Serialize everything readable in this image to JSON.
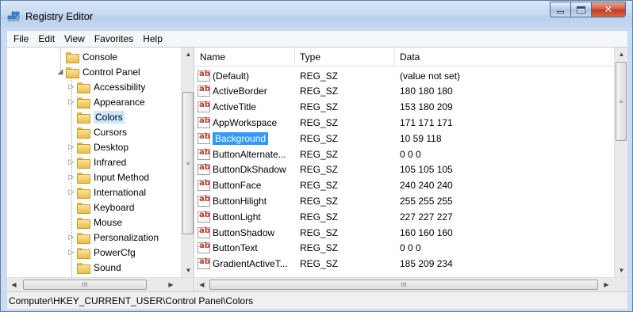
{
  "window": {
    "title": "Registry Editor",
    "close_glyph": "✕"
  },
  "menu": [
    "File",
    "Edit",
    "View",
    "Favorites",
    "Help"
  ],
  "tree": {
    "items": [
      {
        "label": "Console",
        "level": 2,
        "expander": "",
        "selected": false
      },
      {
        "label": "Control Panel",
        "level": 2,
        "expander": "◢",
        "selected": false
      },
      {
        "label": "Accessibility",
        "level": 3,
        "expander": "▷",
        "selected": false
      },
      {
        "label": "Appearance",
        "level": 3,
        "expander": "▷",
        "selected": false
      },
      {
        "label": "Colors",
        "level": 3,
        "expander": "",
        "selected": true
      },
      {
        "label": "Cursors",
        "level": 3,
        "expander": "",
        "selected": false
      },
      {
        "label": "Desktop",
        "level": 3,
        "expander": "▷",
        "selected": false
      },
      {
        "label": "Infrared",
        "level": 3,
        "expander": "▷",
        "selected": false
      },
      {
        "label": "Input Method",
        "level": 3,
        "expander": "▷",
        "selected": false
      },
      {
        "label": "International",
        "level": 3,
        "expander": "▷",
        "selected": false
      },
      {
        "label": "Keyboard",
        "level": 3,
        "expander": "",
        "selected": false
      },
      {
        "label": "Mouse",
        "level": 3,
        "expander": "",
        "selected": false
      },
      {
        "label": "Personalization",
        "level": 3,
        "expander": "▷",
        "selected": false
      },
      {
        "label": "PowerCfg",
        "level": 3,
        "expander": "▷",
        "selected": false
      },
      {
        "label": "Sound",
        "level": 3,
        "expander": "",
        "selected": false
      }
    ],
    "hscroll_grip": "III",
    "vscroll_grip": "≡"
  },
  "values_pane": {
    "columns": [
      "Name",
      "Type",
      "Data"
    ],
    "rows": [
      {
        "name": "(Default)",
        "type": "REG_SZ",
        "data": "(value not set)",
        "selected": false
      },
      {
        "name": "ActiveBorder",
        "type": "REG_SZ",
        "data": "180 180 180",
        "selected": false
      },
      {
        "name": "ActiveTitle",
        "type": "REG_SZ",
        "data": "153 180 209",
        "selected": false
      },
      {
        "name": "AppWorkspace",
        "type": "REG_SZ",
        "data": "171 171 171",
        "selected": false
      },
      {
        "name": "Background",
        "type": "REG_SZ",
        "data": "10 59 118",
        "selected": true
      },
      {
        "name": "ButtonAlternate...",
        "type": "REG_SZ",
        "data": "0 0 0",
        "selected": false
      },
      {
        "name": "ButtonDkShadow",
        "type": "REG_SZ",
        "data": "105 105 105",
        "selected": false
      },
      {
        "name": "ButtonFace",
        "type": "REG_SZ",
        "data": "240 240 240",
        "selected": false
      },
      {
        "name": "ButtonHilight",
        "type": "REG_SZ",
        "data": "255 255 255",
        "selected": false
      },
      {
        "name": "ButtonLight",
        "type": "REG_SZ",
        "data": "227 227 227",
        "selected": false
      },
      {
        "name": "ButtonShadow",
        "type": "REG_SZ",
        "data": "160 160 160",
        "selected": false
      },
      {
        "name": "ButtonText",
        "type": "REG_SZ",
        "data": "0 0 0",
        "selected": false
      },
      {
        "name": "GradientActiveT...",
        "type": "REG_SZ",
        "data": "185 209 234",
        "selected": false
      }
    ],
    "value_icon_text": "ab",
    "hscroll_grip": "III",
    "vscroll_grip": "≡"
  },
  "status": {
    "path": "Computer\\HKEY_CURRENT_USER\\Control Panel\\Colors"
  },
  "colors": {
    "selection": "#3399ff",
    "selection_inactive": "#cce8ff"
  }
}
